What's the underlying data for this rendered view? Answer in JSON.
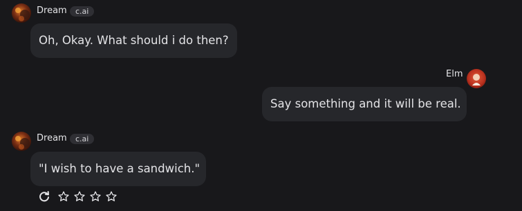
{
  "messages": [
    {
      "author": "Dream",
      "badge": "c.ai",
      "text": "Oh, Okay. What should i do then?",
      "avatar": "dream-avatar"
    },
    {
      "author": "Elm",
      "text": "Say something and it will be real.",
      "avatar": "elm-avatar"
    },
    {
      "author": "Dream",
      "badge": "c.ai",
      "text": "\"I wish to have a sandwich.\"",
      "avatar": "dream-avatar"
    }
  ],
  "actions": {
    "regenerate_icon": "refresh-icon",
    "rating_icon": "star-outline-icon",
    "rating": 0,
    "rating_max": 4
  },
  "colors": {
    "background": "#18181b",
    "bubble": "#26272b",
    "text": "#e4e4e7",
    "badge_bg": "#2f2f34"
  }
}
